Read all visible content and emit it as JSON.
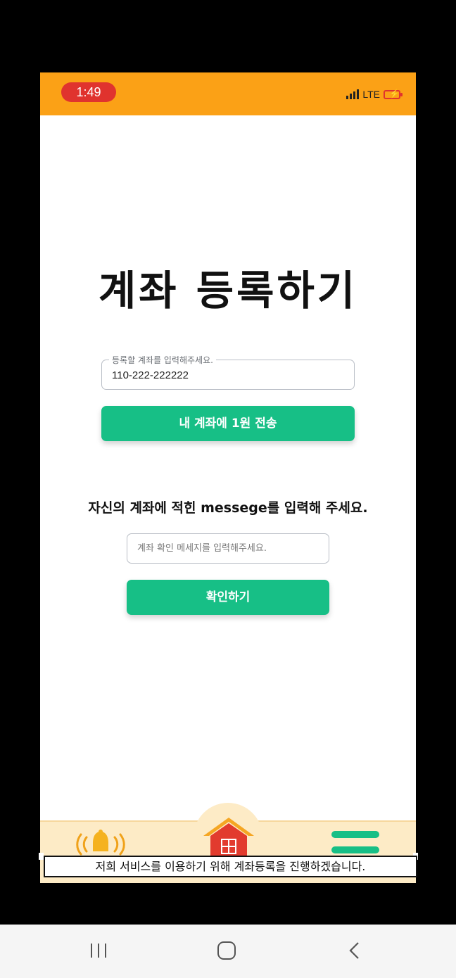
{
  "status_bar": {
    "time": "1:49",
    "network": "LTE",
    "background_color": "#fba116",
    "time_pill_color": "#e0332e"
  },
  "page": {
    "title": "계좌 등록하기",
    "account_field": {
      "label": "등록할 계좌를 입력해주세요.",
      "value": "110-222-222222"
    },
    "send_button_label": "내 계좌에 1원 전송",
    "instruction": "자신의 계좌에 적힌 messege를 입력해 주세요.",
    "message_field": {
      "placeholder": "계좌 확인 메세지를 입력해주세요.",
      "value": ""
    },
    "confirm_button_label": "확인하기",
    "accent_color": "#17bf86"
  },
  "bottom_nav": {
    "items": [
      {
        "icon": "bell-icon",
        "label": ""
      },
      {
        "icon": "home-icon",
        "label": ""
      },
      {
        "icon": "menu-icon",
        "label": ""
      }
    ],
    "background_color": "#fdebc6"
  },
  "caption": "저희 서비스를 이용하기 위해 계좌등록을 진행하겠습니다.",
  "system_nav": {
    "items": [
      {
        "icon": "recent-apps-icon"
      },
      {
        "icon": "home-circle-icon"
      },
      {
        "icon": "back-icon"
      }
    ]
  }
}
